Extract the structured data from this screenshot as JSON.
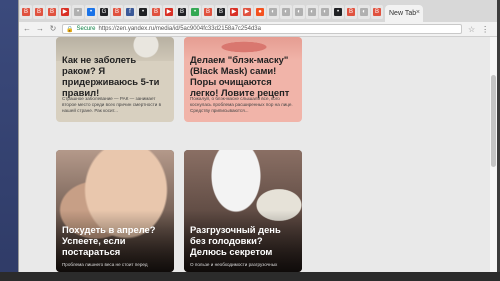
{
  "browser": {
    "new_tab_label": "New Tab",
    "close_glyph": "×",
    "url_secure": "Secure",
    "url": "https://zen.yandex.ru/media/id/5ac9004fc33d2158a7c254d3a",
    "mini_tabs": [
      {
        "color": "#e0523f",
        "glyph": "B"
      },
      {
        "color": "#e0523f",
        "glyph": "B"
      },
      {
        "color": "#e0523f",
        "glyph": "B"
      },
      {
        "color": "#d93025",
        "glyph": "▶"
      },
      {
        "color": "#b0b0b0",
        "glyph": "•"
      },
      {
        "color": "#1a73e8",
        "glyph": "•"
      },
      {
        "color": "#202124",
        "glyph": "G"
      },
      {
        "color": "#e0523f",
        "glyph": "B"
      },
      {
        "color": "#3b5998",
        "glyph": "f"
      },
      {
        "color": "#202124",
        "glyph": "•"
      },
      {
        "color": "#e0523f",
        "glyph": "B"
      },
      {
        "color": "#d93025",
        "glyph": "▶"
      },
      {
        "color": "#202124",
        "glyph": "B"
      },
      {
        "color": "#34a853",
        "glyph": "•"
      },
      {
        "color": "#e0523f",
        "glyph": "B"
      },
      {
        "color": "#202124",
        "glyph": "B"
      },
      {
        "color": "#d93025",
        "glyph": "▶"
      },
      {
        "color": "#e0523f",
        "glyph": "▶"
      },
      {
        "color": "#f4511e",
        "glyph": "●"
      },
      {
        "color": "#b0b0b0",
        "glyph": "◐"
      },
      {
        "color": "#b0b0b0",
        "glyph": "◐"
      },
      {
        "color": "#b0b0b0",
        "glyph": "◐"
      },
      {
        "color": "#b0b0b0",
        "glyph": "◐"
      },
      {
        "color": "#b0b0b0",
        "glyph": "◐"
      },
      {
        "color": "#202124",
        "glyph": "•"
      },
      {
        "color": "#e0523f",
        "glyph": "B"
      },
      {
        "color": "#b0b0b0",
        "glyph": "◐"
      },
      {
        "color": "#e0523f",
        "glyph": "B"
      }
    ]
  },
  "cards": [
    {
      "title": "Как не заболеть раком? Я придерживаюсь 5-ти правил!",
      "excerpt": "Страшное заболевание — РАК — занимает второе место среди всех причин смертности в нашей стране. Рак косит..."
    },
    {
      "title": "Делаем \"блэк-маску\" (Black Mask) сами! Поры очищаются легко! Ловите рецепт",
      "excerpt": "Пожалуй, о блэк-маске слышали все, кого коснулась проблема расширенных пор на лице. Средству приписываются..."
    },
    {
      "title": "Похудеть в апреле? Успеете, если постараться",
      "excerpt": "Проблема лишнего веса не стоит перед"
    },
    {
      "title": "Разгрузочный день без голодовки? Делюсь секретом",
      "excerpt": "О пользе и необходимости разгрузочных"
    }
  ]
}
